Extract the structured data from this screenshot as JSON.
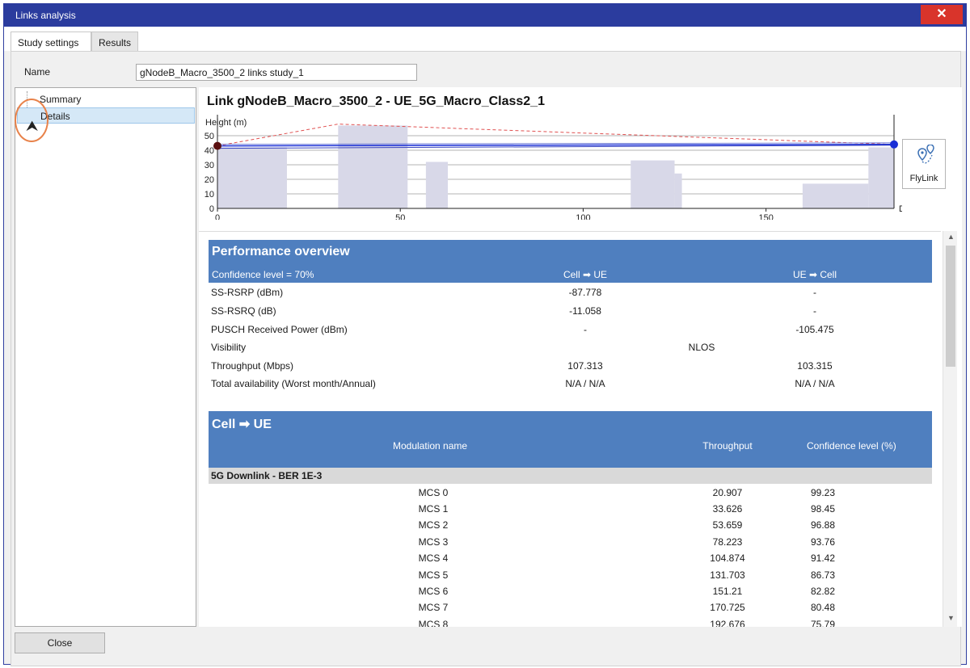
{
  "window": {
    "title": "Links analysis",
    "close_glyph": "✕"
  },
  "tabs": [
    {
      "label": "Study settings"
    },
    {
      "label": "Results"
    }
  ],
  "name_field": {
    "label": "Name",
    "value": "gNodeB_Macro_3500_2 links study_1"
  },
  "tree": {
    "items": [
      {
        "label": "Summary"
      },
      {
        "label": "Details"
      }
    ]
  },
  "link_title": "Link gNodeB_Macro_3500_2 - UE_5G_Macro_Class2_1",
  "flylink": {
    "label": "FlyLink",
    "icon": "route-pin-icon"
  },
  "chart_data": {
    "type": "area",
    "ylabel": "Height (m)",
    "xlabel": "Distance (m)",
    "xlim": [
      0,
      185
    ],
    "ylim": [
      0,
      60
    ],
    "xticks": [
      0,
      50,
      100,
      150
    ],
    "yticks": [
      0,
      10,
      20,
      30,
      40,
      50
    ],
    "grid": true,
    "obstacles": [
      {
        "x0": 0,
        "x1": 19,
        "h": 42
      },
      {
        "x0": 33,
        "x1": 52,
        "h": 57
      },
      {
        "x0": 57,
        "x1": 63,
        "h": 32
      },
      {
        "x0": 113,
        "x1": 125,
        "h": 33
      },
      {
        "x0": 125,
        "x1": 127,
        "h": 24
      },
      {
        "x0": 160,
        "x1": 178,
        "h": 17
      },
      {
        "x0": 178,
        "x1": 185,
        "h": 42
      }
    ],
    "los_line": {
      "x": [
        0,
        185
      ],
      "y": [
        43,
        44
      ]
    },
    "fresnel_upper": {
      "x": [
        0,
        33,
        185
      ],
      "y": [
        43,
        58,
        44
      ]
    },
    "endpoints": [
      {
        "x": 0,
        "y": 43,
        "color": "#5a0f0f"
      },
      {
        "x": 185,
        "y": 44,
        "color": "#1a2fd6"
      }
    ]
  },
  "performance": {
    "title": "Performance overview",
    "confidence": "Confidence level = 70%",
    "col1": "Cell ➡ UE",
    "col2": "UE ➡ Cell",
    "rows": [
      {
        "label": "SS-RSRP (dBm)",
        "v1": "-87.778",
        "v2": "-"
      },
      {
        "label": "SS-RSRQ (dB)",
        "v1": "-11.058",
        "v2": "-"
      },
      {
        "label": "PUSCH Received Power (dBm)",
        "v1": "-",
        "v2": "-105.475"
      },
      {
        "label": "Visibility",
        "merged": "NLOS"
      },
      {
        "label": "Throughput (Mbps)",
        "v1": "107.313",
        "v2": "103.315"
      },
      {
        "label": "Total availability (Worst month/Annual)",
        "v1": "N/A / N/A",
        "v2": "N/A / N/A"
      }
    ]
  },
  "cell_ue": {
    "title": "Cell ➡ UE",
    "col_mod": "Modulation name",
    "col_thr": "Throughput",
    "col_conf": "Confidence level (%)",
    "group": "5G Downlink - BER 1E-3",
    "rows": [
      {
        "mod": "MCS 0",
        "thr": "20.907",
        "conf": "99.23"
      },
      {
        "mod": "MCS 1",
        "thr": "33.626",
        "conf": "98.45"
      },
      {
        "mod": "MCS 2",
        "thr": "53.659",
        "conf": "96.88"
      },
      {
        "mod": "MCS 3",
        "thr": "78.223",
        "conf": "93.76"
      },
      {
        "mod": "MCS 4",
        "thr": "104.874",
        "conf": "91.42"
      },
      {
        "mod": "MCS 5",
        "thr": "131.703",
        "conf": "86.73"
      },
      {
        "mod": "MCS 6",
        "thr": "151.21",
        "conf": "82.82"
      },
      {
        "mod": "MCS 7",
        "thr": "170.725",
        "conf": "80.48"
      },
      {
        "mod": "MCS 8",
        "thr": "192.676",
        "conf": "75.79"
      }
    ]
  },
  "footer": {
    "close_label": "Close"
  }
}
